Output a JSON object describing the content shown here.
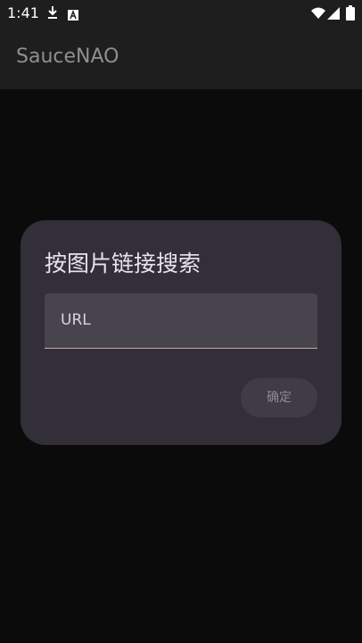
{
  "status_bar": {
    "time": "1:41",
    "icons": [
      "download-icon",
      "a-icon",
      "wifi-icon",
      "signal-icon",
      "battery-icon"
    ]
  },
  "app_bar": {
    "title": "SauceNAO"
  },
  "dialog": {
    "title": "按图片链接搜索",
    "url_field": {
      "label": "URL",
      "value": ""
    },
    "confirm_label": "确定"
  },
  "colors": {
    "background": "#0b0b0b",
    "app_bar": "#1e1e1e",
    "dialog": "#322f39",
    "field": "#47444e",
    "field_underline": "#c7a9a9"
  }
}
